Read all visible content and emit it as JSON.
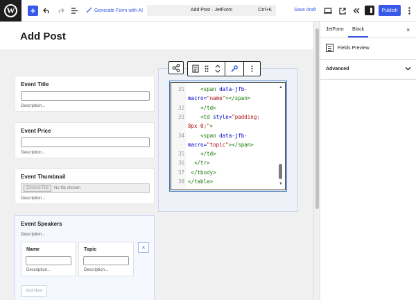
{
  "topbar": {
    "generate_form_label": "Generate Form with AI",
    "command_title": "Add Post · JetForm",
    "command_shortcut": "Ctrl+K",
    "save_draft_label": "Save draft",
    "publish_label": "Publish",
    "accent_color": "#3858e9"
  },
  "editor": {
    "page_title": "Add Post",
    "fields": [
      {
        "label": "Event Title",
        "description": "Description..."
      },
      {
        "label": "Event Price",
        "description": "Description..."
      },
      {
        "label": "Event Thumbnail",
        "description": "Description...",
        "file_button": "Choose File",
        "file_status": "No file chosen"
      }
    ],
    "repeater": {
      "label": "Event Speakers",
      "description": "Description...",
      "sub_fields": [
        {
          "label": "Name",
          "description": "Description..."
        },
        {
          "label": "Topic",
          "description": "Description..."
        }
      ],
      "remove_label": "×",
      "add_new_label": "Add New"
    }
  },
  "code_editor": {
    "lines": [
      {
        "num": "31",
        "parts": [
          {
            "t": "    ",
            "c": ""
          },
          {
            "t": "<span ",
            "c": "tag"
          },
          {
            "t": "data-jfb-",
            "c": "attr"
          }
        ]
      },
      {
        "num": "",
        "parts": [
          {
            "t": "macro=",
            "c": "attr"
          },
          {
            "t": "\"name\"",
            "c": "str"
          },
          {
            "t": "></span>",
            "c": "tag"
          }
        ]
      },
      {
        "num": "32",
        "parts": [
          {
            "t": "    ",
            "c": ""
          },
          {
            "t": "</td>",
            "c": "tag"
          }
        ]
      },
      {
        "num": "33",
        "parts": [
          {
            "t": "    ",
            "c": ""
          },
          {
            "t": "<td ",
            "c": "tag"
          },
          {
            "t": "style=",
            "c": "attr"
          },
          {
            "t": "\"padding:",
            "c": "str"
          }
        ]
      },
      {
        "num": "",
        "parts": [
          {
            "t": "8px 0;\"",
            "c": "str"
          },
          {
            "t": ">",
            "c": "tag"
          }
        ]
      },
      {
        "num": "34",
        "parts": [
          {
            "t": "    ",
            "c": ""
          },
          {
            "t": "<span ",
            "c": "tag"
          },
          {
            "t": "data-jfb-",
            "c": "attr"
          }
        ]
      },
      {
        "num": "",
        "parts": [
          {
            "t": "macro=",
            "c": "attr"
          },
          {
            "t": "\"topic\"",
            "c": "str"
          },
          {
            "t": "></span>",
            "c": "tag"
          }
        ]
      },
      {
        "num": "35",
        "parts": [
          {
            "t": "    ",
            "c": ""
          },
          {
            "t": "</td>",
            "c": "tag"
          }
        ]
      },
      {
        "num": "36",
        "parts": [
          {
            "t": "  ",
            "c": ""
          },
          {
            "t": "</tr>",
            "c": "tag"
          }
        ]
      },
      {
        "num": "37",
        "parts": [
          {
            "t": " ",
            "c": ""
          },
          {
            "t": "</tbody>",
            "c": "tag"
          }
        ]
      },
      {
        "num": "38",
        "parts": [
          {
            "t": "</table>",
            "c": "tag"
          }
        ]
      }
    ]
  },
  "sidebar": {
    "tabs": [
      {
        "label": "JetForm",
        "active": false
      },
      {
        "label": "Block",
        "active": true
      }
    ],
    "close_label": "×",
    "fields_preview_label": "Fields Preview",
    "advanced_label": "Advanced"
  }
}
